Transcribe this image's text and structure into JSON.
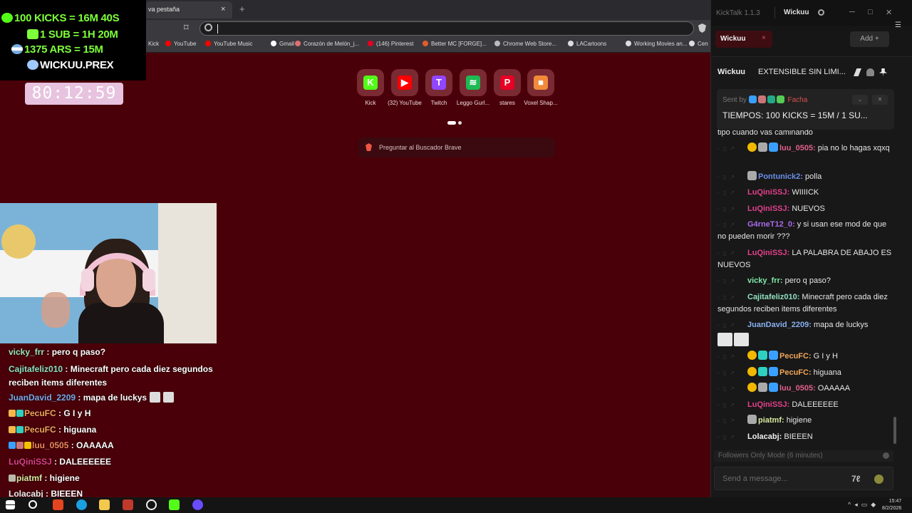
{
  "browser": {
    "tab_title": "va pestaña",
    "tab_close": "×",
    "new_tab": "+",
    "omnibox_value": "",
    "bookmarks": [
      {
        "label": "Kick",
        "color": "#53fc18"
      },
      {
        "label": "YouTube",
        "color": "#ff0000"
      },
      {
        "label": "YouTube Music",
        "color": "#ff0000"
      },
      {
        "label": "Gmail",
        "color": "#ffffff"
      },
      {
        "label": "Corazón de Melón_j...",
        "color": "#e07070"
      },
      {
        "label": "(146) Pinterest",
        "color": "#e60023"
      },
      {
        "label": "Better MC [FORGE]...",
        "color": "#e35b2e"
      },
      {
        "label": "Chrome Web Store...",
        "color": "#bbbbbb"
      },
      {
        "label": "LACartoons",
        "color": "#dddddd"
      },
      {
        "label": "Working Movies an...",
        "color": "#dddddd"
      },
      {
        "label": "Cen",
        "color": "#dddddd"
      }
    ],
    "tiles": [
      {
        "label": "Kick",
        "color": "#53fc18",
        "glyph": "K"
      },
      {
        "label": "(32) YouTube",
        "color": "#ff0000",
        "glyph": "▶"
      },
      {
        "label": "Twitch",
        "color": "#9146ff",
        "glyph": "T"
      },
      {
        "label": "Leggo Gurl...",
        "color": "#1db954",
        "glyph": "≋"
      },
      {
        "label": "stares",
        "color": "#e60023",
        "glyph": "P"
      },
      {
        "label": "Voxel Shap...",
        "color": "#f08a3a",
        "glyph": "■"
      }
    ],
    "ask_placeholder": "Preguntar al Buscador Brave"
  },
  "overlay": {
    "lines": [
      "100 KICKS = 16M 40S",
      "1 SUB = 1H 20M",
      "1375 ARS = 15M",
      "WICKUU.PREX"
    ],
    "timer": "80:12:59"
  },
  "stream_chat": [
    {
      "user": "vicky_frr",
      "color": "#9be3b5",
      "text": " : pero q paso?"
    },
    {
      "user": "Cajitafeliz010",
      "color": "#8fe0c0",
      "text": " : Minecraft pero cada diez segundos reciben items diferentes"
    },
    {
      "user": "JuanDavid_2209",
      "color": "#7aa8e8",
      "text": " : mapa de luckys"
    },
    {
      "user": "PecuFC",
      "color": "#f2a65a",
      "text": " : G I y H"
    },
    {
      "user": "PecuFC",
      "color": "#f2a65a",
      "text": " : higuana"
    },
    {
      "user": "luu_0505",
      "color": "#f08a5a",
      "text": " : OAAAAA"
    },
    {
      "user": "LuQiniSSJ",
      "color": "#e0408a",
      "text": " : DALEEEEEE"
    },
    {
      "user": "piatmf",
      "color": "#d8e8a0",
      "text": " : higiene"
    },
    {
      "user": "Lolacabj",
      "color": "#f0f0f0",
      "text": " : BIEEEN"
    }
  ],
  "kicktalk": {
    "app_name": "KickTalk 1.1.3",
    "user": "Wickuu",
    "window_controls": [
      "─",
      "□",
      "✕"
    ],
    "channel_tab": "Wickuu",
    "channel_tab_close": "×",
    "add_label": "Add  +",
    "channel_name": "Wickuu",
    "channel_title": "EXTENSIBLE SIN LIMI...",
    "pinned": {
      "sent_by_label": "Sent by",
      "sender": "Facha",
      "message": "TIEMPOS: 100 KICKS = 15M / 1 SU..."
    },
    "messages": [
      {
        "user": "",
        "color": "#e6e6e6",
        "text": "tipo cuando vas caminando"
      },
      {
        "user": "luu_0505:",
        "color": "#e0608a",
        "text": " pia no lo hagas xqxq"
      },
      {
        "user": "Pontunick2:",
        "color": "#6a8fe8",
        "text": " polla"
      },
      {
        "user": "LuQiniSSJ:",
        "color": "#e0408a",
        "text": " WIIIICK"
      },
      {
        "user": "LuQiniSSJ:",
        "color": "#e0408a",
        "text": " NUEVOS"
      },
      {
        "user": "G4rneT12_0:",
        "color": "#a86ae8",
        "text": " y si usan ese mod de que no pueden morir ???"
      },
      {
        "user": "LuQiniSSJ:",
        "color": "#e0408a",
        "text": " LA PALABRA DE ABAJO ES NUEVOS"
      },
      {
        "user": "vicky_frr:",
        "color": "#7fe8a8",
        "text": " pero q paso?"
      },
      {
        "user": "Cajitafeliz010:",
        "color": "#8fe0c0",
        "text": " Minecraft pero cada diez segundos reciben items diferentes"
      },
      {
        "user": "JuanDavid_2209:",
        "color": "#8ab0f0",
        "text": " mapa de luckys"
      },
      {
        "user": "PecuFC:",
        "color": "#f2a65a",
        "text": " G I y H"
      },
      {
        "user": "PecuFC:",
        "color": "#f2a65a",
        "text": " higuana"
      },
      {
        "user": "luu_0505:",
        "color": "#e0608a",
        "text": " OAAAAA"
      },
      {
        "user": "LuQiniSSJ:",
        "color": "#e0408a",
        "text": " DALEEEEEE"
      },
      {
        "user": "piatmf:",
        "color": "#d8e8a0",
        "text": " higiene"
      },
      {
        "user": "Lolacabj:",
        "color": "#f0f0f0",
        "text": " BIEEEN"
      }
    ],
    "followers_mode": "Followers Only Mode (6 minutes)",
    "input_placeholder": "Send a message..."
  },
  "taskbar": {
    "time": "15:47",
    "date": "8/2/2026"
  }
}
